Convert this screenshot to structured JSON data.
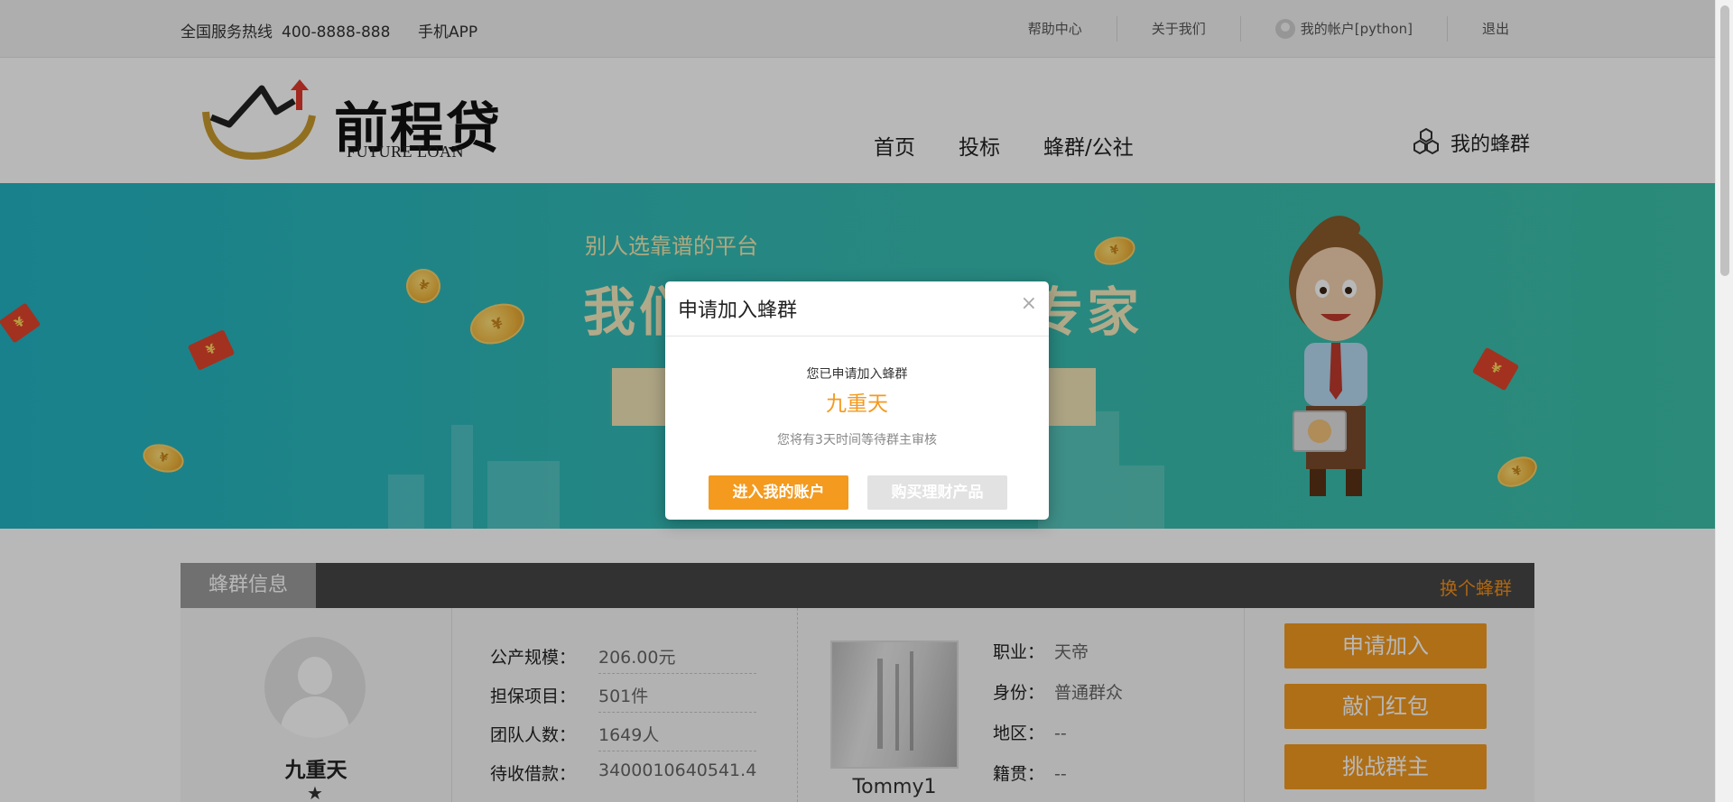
{
  "topbar": {
    "hotline_label": "全国服务热线",
    "hotline_number": "400-8888-888",
    "app": "手机APP",
    "help": "帮助中心",
    "about": "关于我们",
    "account": "我的帐户[python]",
    "logout": "退出"
  },
  "header": {
    "logo_cn": "前程贷",
    "logo_en": "FUTURE LOAN",
    "nav": [
      "首页",
      "投标",
      "蜂群/公社"
    ],
    "my_group": "我的蜂群"
  },
  "banner": {
    "subtitle": "别人选靠谱的平台",
    "headline": "我们选靠谱的理财专家"
  },
  "group_info": {
    "tab": "蜂群信息",
    "change": "换个蜂群",
    "name": "九重天",
    "stats": [
      {
        "label": "公产规模：",
        "value": "206.00元"
      },
      {
        "label": "担保项目：",
        "value": "501件"
      },
      {
        "label": "团队人数：",
        "value": "1649人"
      },
      {
        "label": "待收借款：",
        "value": "3400010640541.4"
      }
    ],
    "owner": "Tommy1",
    "details": [
      {
        "label": "职业：",
        "value": "天帝"
      },
      {
        "label": "身份：",
        "value": "普通群众"
      },
      {
        "label": "地区：",
        "value": "--"
      },
      {
        "label": "籍贯：",
        "value": "--"
      }
    ],
    "buttons": [
      "申请加入",
      "敲门红包",
      "挑战群主"
    ]
  },
  "modal": {
    "title": "申请加入蜂群",
    "close": "×",
    "line1": "您已申请加入蜂群",
    "group_name": "九重天",
    "line2": "您将有3天时间等待群主审核",
    "primary_button": "进入我的账户",
    "secondary_button": "购买理财产品"
  },
  "colors": {
    "accent": "#f39a1f",
    "banner": "#35bcb4",
    "tab_bar": "#464646"
  }
}
